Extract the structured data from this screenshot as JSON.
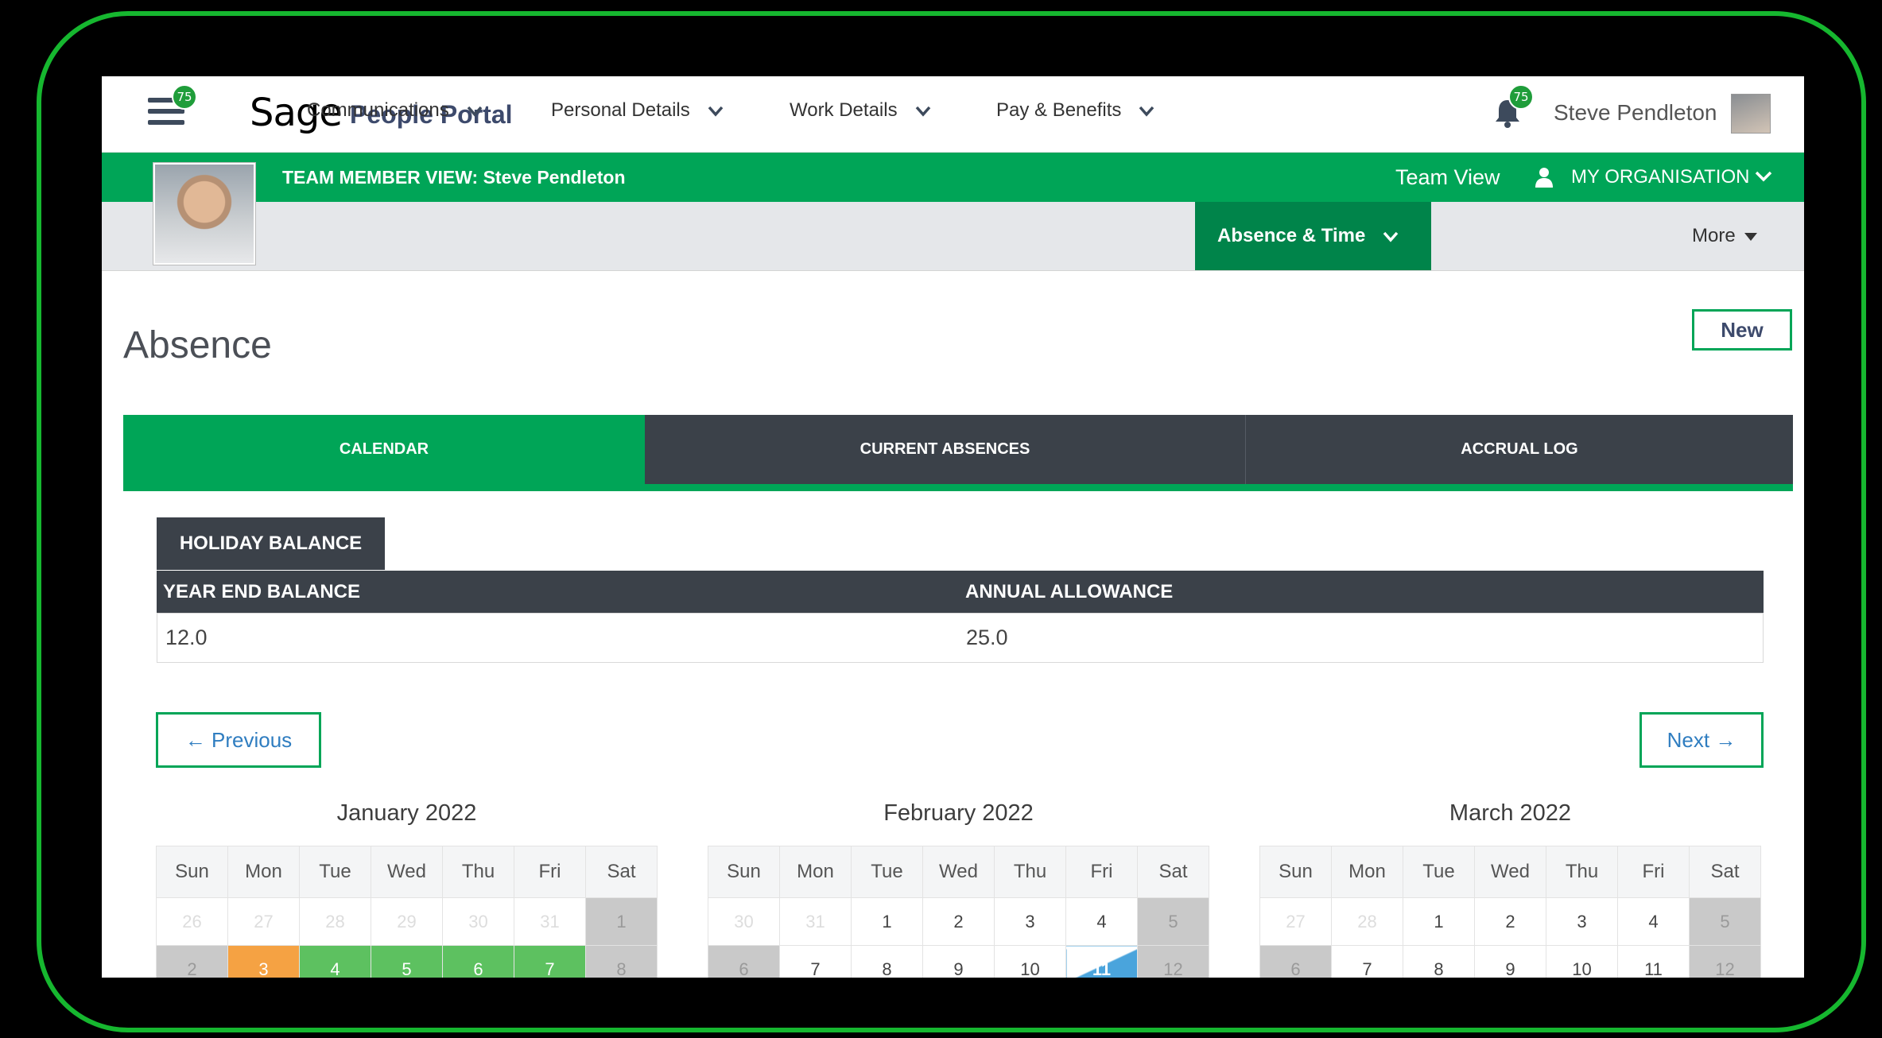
{
  "header": {
    "menu_badge": "75",
    "logo": "Sage",
    "portal_name": "People Portal",
    "notification_badge": "75",
    "user_name": "Steve Pendleton"
  },
  "greenbar": {
    "team_member_view": "TEAM MEMBER VIEW: Steve Pendleton",
    "team_view": "Team View",
    "org_menu": "MY ORGANISATION"
  },
  "nav": {
    "items": [
      {
        "label": "Communications"
      },
      {
        "label": "Personal Details"
      },
      {
        "label": "Work Details"
      },
      {
        "label": "Pay & Benefits"
      },
      {
        "label": "Absence & Time",
        "active": true
      }
    ],
    "more": "More"
  },
  "page": {
    "title": "Absence",
    "new_button": "New"
  },
  "tabs": [
    {
      "label": "CALENDAR",
      "active": true
    },
    {
      "label": "CURRENT ABSENCES"
    },
    {
      "label": "ACCRUAL LOG"
    }
  ],
  "holiday_balance": {
    "tab_label": "HOLIDAY BALANCE",
    "columns": [
      "YEAR END BALANCE",
      "ANNUAL ALLOWANCE"
    ],
    "values": [
      "12.0",
      "25.0"
    ]
  },
  "pager": {
    "previous": "← Previous",
    "next": "Next →"
  },
  "calendar": {
    "weekdays": [
      "Sun",
      "Mon",
      "Tue",
      "Wed",
      "Thu",
      "Fri",
      "Sat"
    ],
    "months": [
      {
        "title": "January 2022",
        "rows": [
          [
            "26",
            "27",
            "28",
            "29",
            "30",
            "31",
            "1"
          ],
          [
            "2",
            "3",
            "4",
            "5",
            "6",
            "7",
            "8"
          ]
        ]
      },
      {
        "title": "February 2022",
        "rows": [
          [
            "30",
            "31",
            "1",
            "2",
            "3",
            "4",
            "5"
          ],
          [
            "6",
            "7",
            "8",
            "9",
            "10",
            "11",
            "12"
          ]
        ]
      },
      {
        "title": "March 2022",
        "rows": [
          [
            "27",
            "28",
            "1",
            "2",
            "3",
            "4",
            "5"
          ],
          [
            "6",
            "7",
            "8",
            "9",
            "10",
            "11",
            "12"
          ]
        ]
      }
    ],
    "colors": {
      "holiday": "#f5a243",
      "approved": "#5dc160",
      "half_day": "#4aa4dc",
      "weekend": "#c9c9c9"
    }
  }
}
